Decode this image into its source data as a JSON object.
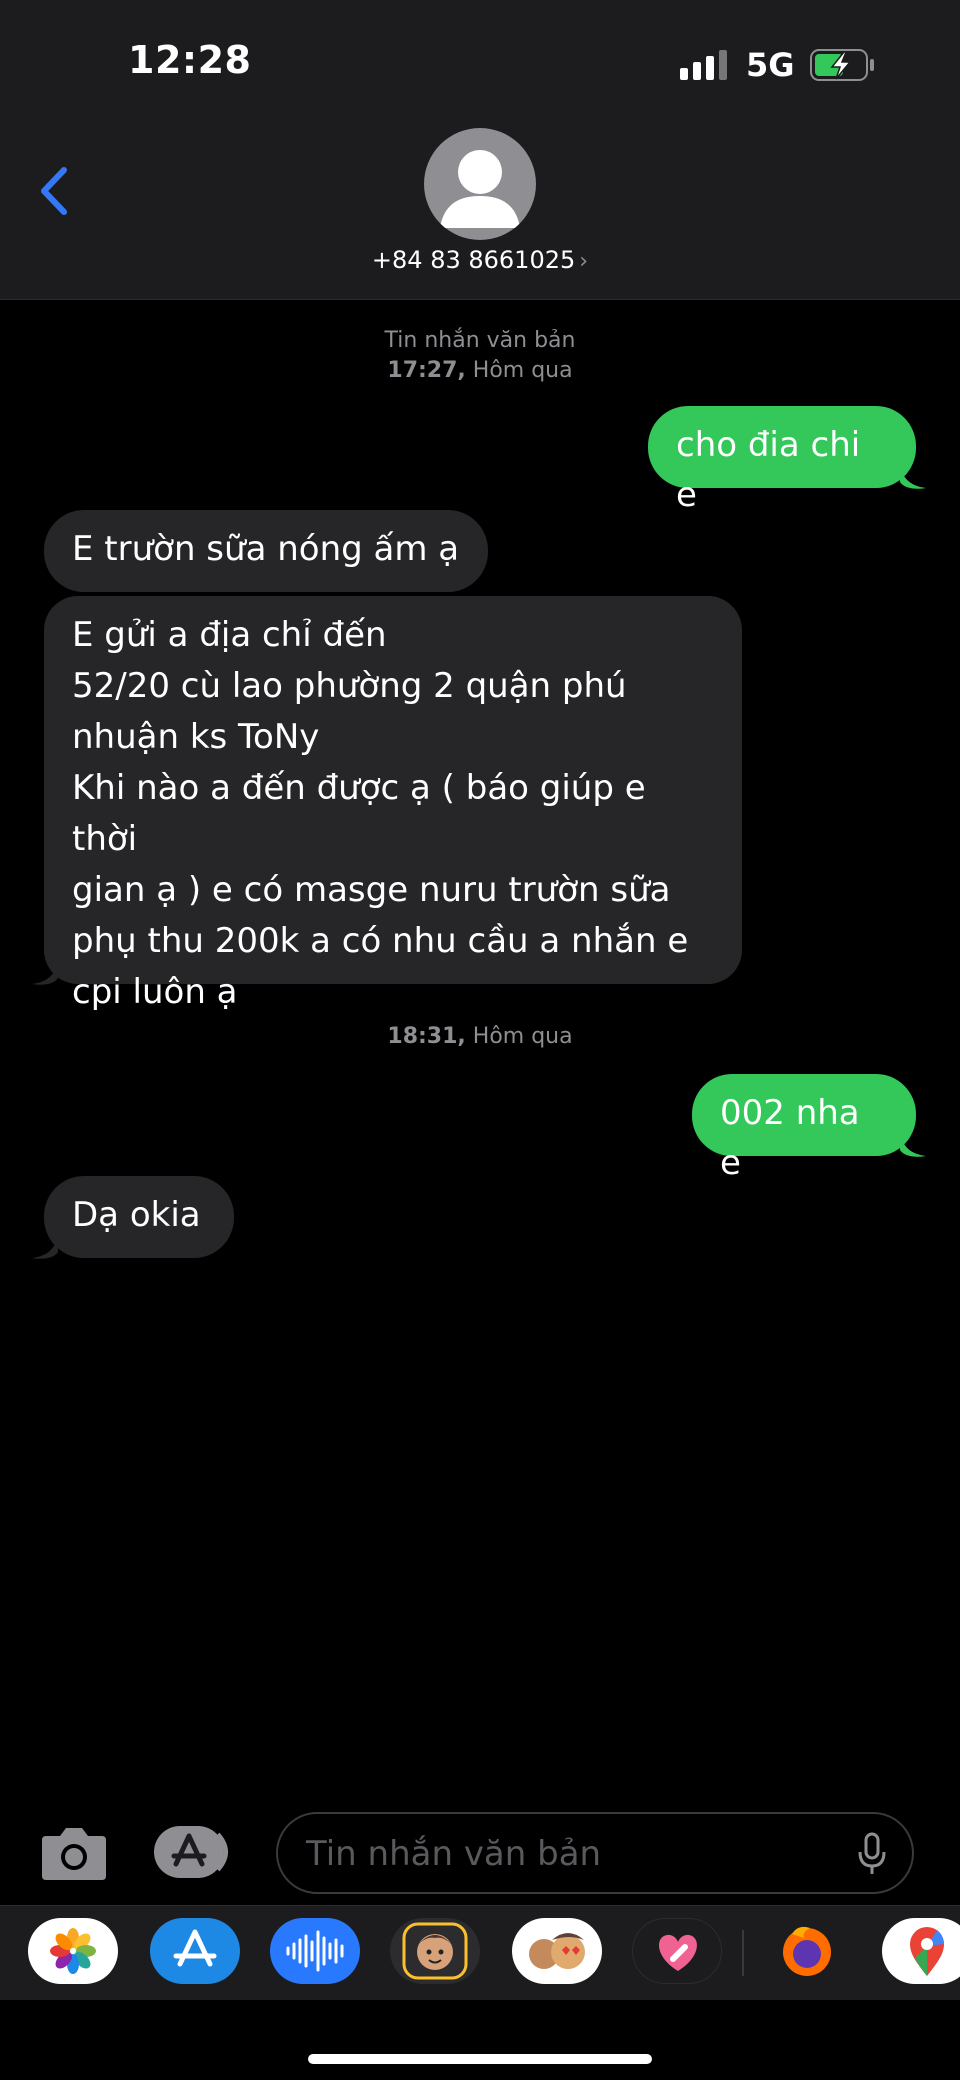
{
  "status": {
    "time": "12:28",
    "network": "5G"
  },
  "header": {
    "contact": "+84 83 8661025"
  },
  "conversation": {
    "meta1": {
      "label": "Tin nhắn văn bản",
      "time": "17:27,",
      "day": "Hôm qua"
    },
    "meta2": {
      "time": "18:31,",
      "day": "Hôm qua"
    },
    "messages": [
      {
        "direction": "out",
        "text": "cho đia chi e"
      },
      {
        "direction": "in",
        "text": "E trườn sữa nóng ấm ạ"
      },
      {
        "direction": "in",
        "lines": [
          "E gửi a địa chỉ đến",
          "52/20 cù lao phường 2 quận phú",
          "nhuận ks ToNy",
          "Khi nào a đến được ạ ( báo giúp e thời",
          "gian ạ ) e có masge nuru trườn sữa",
          "phụ thu 200k a có nhu cầu a nhắn e",
          "cpi luôn ạ"
        ]
      },
      {
        "direction": "out",
        "text": "002 nha e"
      },
      {
        "direction": "in",
        "text": "Dạ okia"
      }
    ]
  },
  "input": {
    "placeholder": "Tin nhắn văn bản"
  },
  "app_tray": [
    "photos-app",
    "app-store-app",
    "audio-message-app",
    "memoji-app",
    "animoji-stickers-app",
    "digital-touch-app",
    "firefox-app",
    "google-maps-app"
  ],
  "colors": {
    "sent_bubble": "#34c759",
    "received_bubble": "#262628",
    "accent": "#3478f6",
    "background": "#000000"
  }
}
